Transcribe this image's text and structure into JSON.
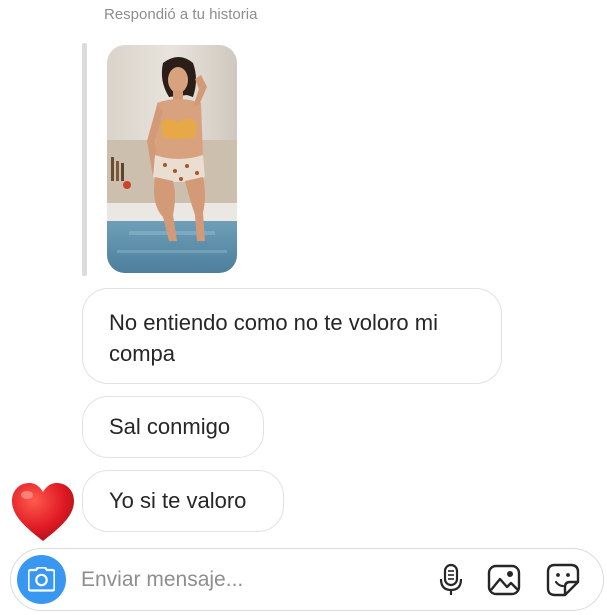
{
  "thread": {
    "reply_label": "Respondió a tu historia",
    "messages": [
      "No entiendo como no te voloro mi\ncompa",
      "Sal conmigo",
      "Yo si te valoro"
    ],
    "reaction_icon": "red-heart-icon"
  },
  "composer": {
    "placeholder": "Enviar mensaje...",
    "camera_icon": "camera-icon",
    "mic_icon": "microphone-icon",
    "gallery_icon": "image-gallery-icon",
    "sticker_icon": "sticker-icon",
    "accent_color": "#3897f0"
  }
}
